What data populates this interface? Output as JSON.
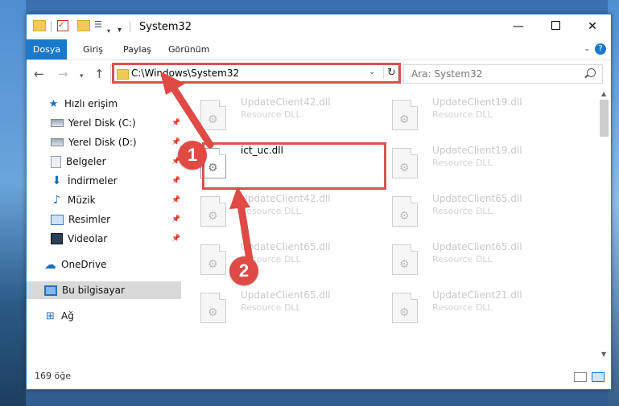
{
  "window": {
    "title": "System32",
    "controls": {
      "minimize": "—",
      "maximize": "",
      "close": "✕"
    }
  },
  "ribbon": {
    "tabs": [
      "Dosya",
      "Giriş",
      "Paylaş",
      "Görünüm"
    ],
    "help": "?"
  },
  "navigation": {
    "back": "←",
    "forward": "→",
    "history": "▾",
    "up": "↑",
    "address": "C:\\Windows\\System32",
    "search_placeholder": "Ara: System32"
  },
  "sidebar": {
    "items": [
      {
        "label": "Hızlı erişim",
        "icon": "star-icon"
      },
      {
        "label": "Yerel Disk (C:)",
        "icon": "drive-icon",
        "pinned": true
      },
      {
        "label": "Yerel Disk (D:)",
        "icon": "drive-icon",
        "pinned": true
      },
      {
        "label": "Belgeler",
        "icon": "document-icon",
        "pinned": true
      },
      {
        "label": "İndirmeler",
        "icon": "download-icon",
        "pinned": true
      },
      {
        "label": "Müzik",
        "icon": "music-icon",
        "pinned": true
      },
      {
        "label": "Resimler",
        "icon": "pictures-icon",
        "pinned": true
      },
      {
        "label": "Videolar",
        "icon": "video-icon",
        "pinned": true
      },
      {
        "label": "OneDrive",
        "icon": "cloud-icon"
      },
      {
        "label": "Bu bilgisayar",
        "icon": "computer-icon",
        "selected": true
      },
      {
        "label": "Ağ",
        "icon": "network-icon"
      }
    ]
  },
  "files": [
    {
      "name": "UpdateClient42.dll",
      "type": "Resource DLL"
    },
    {
      "name": "UpdateClient19.dll",
      "type": "Resource DLL"
    },
    {
      "name": "ict_uc.dll",
      "type": ""
    },
    {
      "name": "UpdateClient19.dll",
      "type": "Resource DLL"
    },
    {
      "name": "UpdateClient42.dll",
      "type": "Resource DLL"
    },
    {
      "name": "UpdateClient65.dll",
      "type": "Resource DLL"
    },
    {
      "name": "UpdateClient65.dll",
      "type": "Resource DLL"
    },
    {
      "name": "UpdateClient65.dll",
      "type": "Resource DLL"
    },
    {
      "name": "UpdateClient65.dll",
      "type": "Resource DLL"
    },
    {
      "name": "UpdateClient21.dll",
      "type": "Resource DLL"
    }
  ],
  "annotations": {
    "step1": "1",
    "step2": "2",
    "accent": "#e04a45"
  },
  "status": {
    "item_count": "169 öğe"
  }
}
